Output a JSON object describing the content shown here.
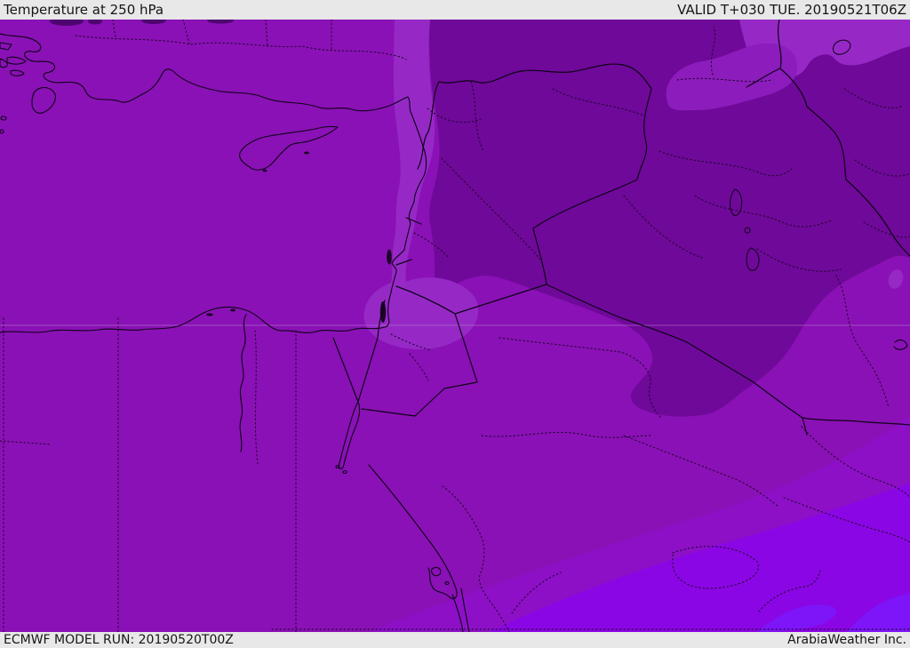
{
  "header": {
    "title": "Temperature at 250 hPa",
    "valid_label": "VALID T+030 TUE. 20190521T06Z"
  },
  "footer": {
    "model_run_label": "ECMWF MODEL RUN: 20190520T00Z",
    "credit_label": "ArabiaWeather Inc."
  },
  "map": {
    "kind": "temperature shading map, Middle East / Eastern Mediterranean region",
    "palette": {
      "band_medium": "#8A11B5",
      "band_dark": "#6F0999",
      "band_light": "#9629C6",
      "band_light2": "#8C1CBB",
      "band_bright1": "#8D10C6",
      "band_bright2": "#8A06E4",
      "band_bright3": "#7D15F8",
      "lake_fill": "#4E0570",
      "bar_background": "#e8e8e8",
      "bar_text": "#151515",
      "coast_line": "#0d0117",
      "admin_dotted_line": "#1c0428",
      "gridline": "#b87fd4"
    }
  }
}
